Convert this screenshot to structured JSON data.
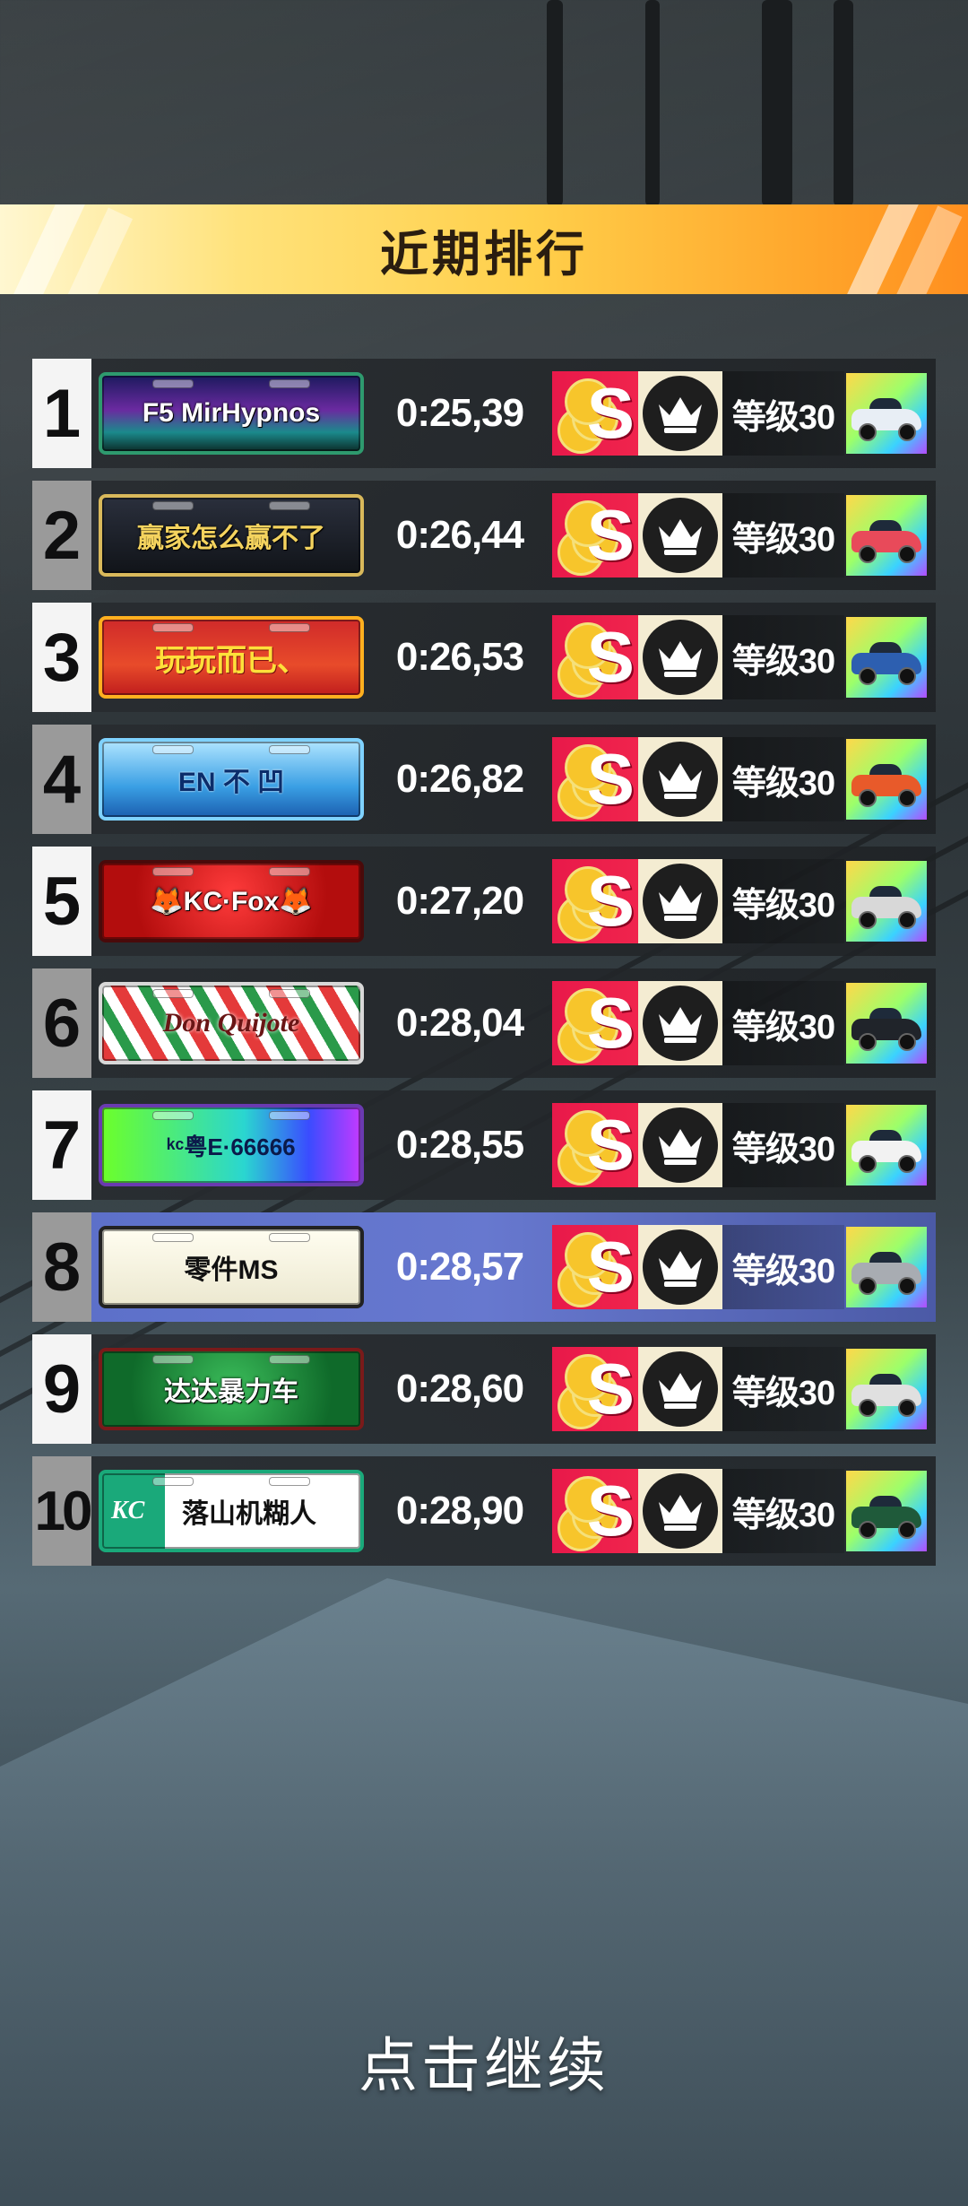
{
  "header": {
    "title": "近期排行"
  },
  "leaderboard": [
    {
      "rank": "1",
      "plate": "F5 MirHypnos",
      "time": "0:25,39",
      "level": "等级30",
      "car_color": "#e8eef5",
      "is_player": false
    },
    {
      "rank": "2",
      "plate": "赢家怎么赢不了",
      "time": "0:26,44",
      "level": "等级30",
      "car_color": "#e84a5a",
      "is_player": false
    },
    {
      "rank": "3",
      "plate": "玩玩而已、",
      "time": "0:26,53",
      "level": "等级30",
      "car_color": "#2d5fb0",
      "is_player": false
    },
    {
      "rank": "4",
      "plate": "EN 不 凹",
      "time": "0:26,82",
      "level": "等级30",
      "car_color": "#e85a2a",
      "is_player": false
    },
    {
      "rank": "5",
      "plate": "🦊KC·Fox🦊",
      "time": "0:27,20",
      "level": "等级30",
      "car_color": "#d8d8d8",
      "is_player": false
    },
    {
      "rank": "6",
      "plate": "Don Quijote",
      "time": "0:28,04",
      "level": "等级30",
      "car_color": "#20242a",
      "is_player": false
    },
    {
      "rank": "7",
      "plate": "ᵏᶜ粤E·66666",
      "time": "0:28,55",
      "level": "等级30",
      "car_color": "#f2f2f2",
      "is_player": false
    },
    {
      "rank": "8",
      "plate": "零件MS",
      "time": "0:28,57",
      "level": "等级30",
      "car_color": "#a8acb2",
      "is_player": true
    },
    {
      "rank": "9",
      "plate": "达达暴力车",
      "time": "0:28,60",
      "level": "等级30",
      "car_color": "#e0e0e0",
      "is_player": false
    },
    {
      "rank": "10",
      "plate": "落山机糊人",
      "time": "0:28,90",
      "level": "等级30",
      "car_color": "#1f5a3a",
      "is_player": false
    }
  ],
  "ten_plate_prefix": "KC",
  "badges": {
    "s_letter": "S"
  },
  "footer": {
    "continue_label": "点击继续"
  },
  "colors": {
    "banner_start": "#fff7d1",
    "banner_end": "#ff8f1f",
    "player_row": "#5b6fc8",
    "badge_red": "#e8194a"
  }
}
